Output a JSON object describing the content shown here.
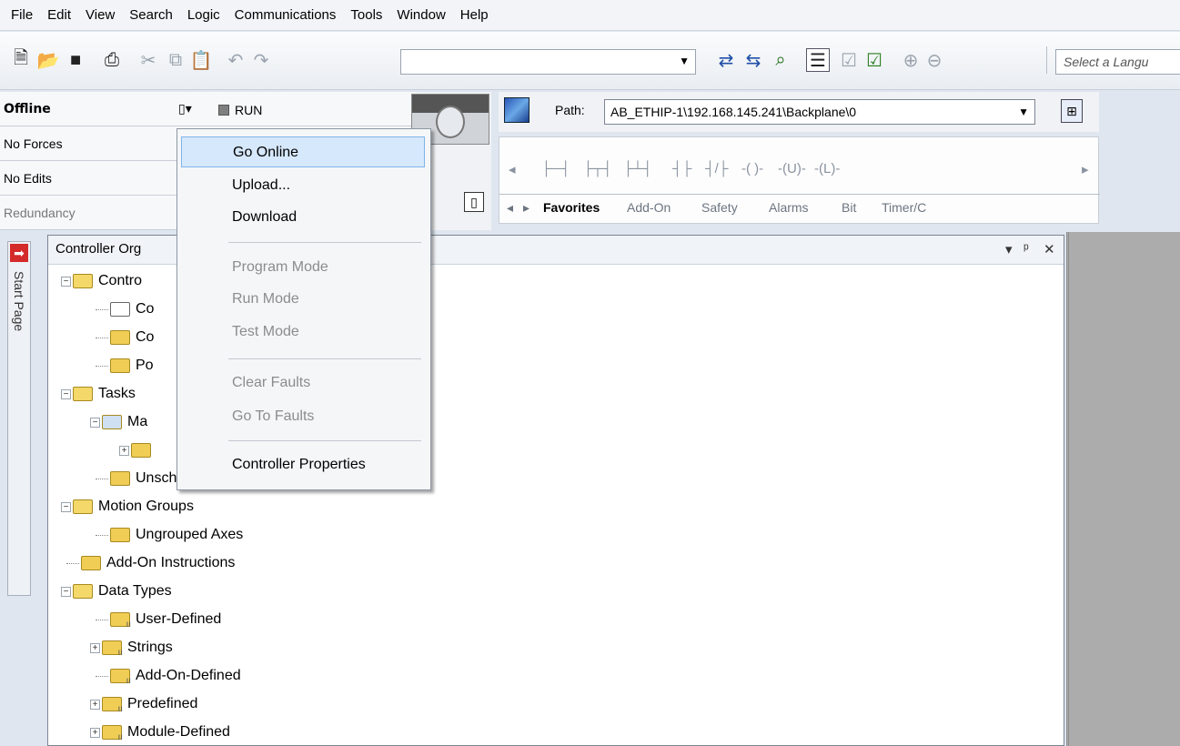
{
  "menubar": {
    "items": [
      "File",
      "Edit",
      "View",
      "Search",
      "Logic",
      "Communications",
      "Tools",
      "Window",
      "Help"
    ]
  },
  "toolbar": {
    "icons": [
      "new-icon",
      "open-icon",
      "save-icon",
      "print-icon",
      "cut-icon",
      "copy-icon",
      "paste-icon",
      "undo-icon",
      "redo-icon",
      "find-icon",
      "find-next-icon",
      "cross-reference-icon",
      "organizer-icon",
      "verify-routine-icon",
      "verify-controller-icon",
      "zoom-in-icon",
      "zoom-out-icon"
    ],
    "search_value": "",
    "language_placeholder": "Select a Langu"
  },
  "status": {
    "offline": "Offline",
    "run": "RUN",
    "no_forces": "No Forces",
    "no_edits": "No Edits",
    "redundancy": "Redundancy"
  },
  "path": {
    "label": "Path:",
    "value": "AB_ETHIP-1\\192.168.145.241\\Backplane\\0"
  },
  "palette": {
    "tabs": [
      "Favorites",
      "Add-On",
      "Safety",
      "Alarms",
      "Bit",
      "Timer/C"
    ]
  },
  "side": {
    "start_page": "Start Page"
  },
  "organizer": {
    "title": "Controller Org",
    "tree": [
      {
        "label": "Contro",
        "indent": 0,
        "expander": "−",
        "icon": "open"
      },
      {
        "label": "Co",
        "indent": 1,
        "icon": "edit"
      },
      {
        "label": "Co",
        "indent": 1,
        "icon": "folder"
      },
      {
        "label": "Po",
        "indent": 1,
        "icon": "folder"
      },
      {
        "label": "Tasks",
        "indent": 0,
        "expander": "−",
        "icon": "open"
      },
      {
        "label": "Ma",
        "indent": 1,
        "expander": "−",
        "icon": "task"
      },
      {
        "label": "",
        "indent": 2,
        "expander": "+",
        "icon": "program"
      },
      {
        "label": "Unscheduled Programs / Phases",
        "indent": 1,
        "icon": "folder"
      },
      {
        "label": "Motion Groups",
        "indent": 0,
        "expander": "−",
        "icon": "open"
      },
      {
        "label": "Ungrouped Axes",
        "indent": 1,
        "icon": "folder"
      },
      {
        "label": "Add-On Instructions",
        "indent": 0,
        "icon": "folder"
      },
      {
        "label": "Data Types",
        "indent": 0,
        "expander": "−",
        "icon": "open"
      },
      {
        "label": "User-Defined",
        "indent": 1,
        "icon": "data"
      },
      {
        "label": "Strings",
        "indent": 1,
        "expander": "+",
        "icon": "data"
      },
      {
        "label": "Add-On-Defined",
        "indent": 1,
        "icon": "data"
      },
      {
        "label": "Predefined",
        "indent": 1,
        "expander": "+",
        "icon": "data"
      },
      {
        "label": "Module-Defined",
        "indent": 1,
        "expander": "+",
        "icon": "data"
      }
    ]
  },
  "context_menu": {
    "items": [
      {
        "label": "Go Online",
        "highlighted": true
      },
      {
        "label": "Upload..."
      },
      {
        "label": "Download"
      },
      {
        "label": "Program Mode",
        "disabled": true
      },
      {
        "label": "Run Mode",
        "disabled": true
      },
      {
        "label": "Test Mode",
        "disabled": true
      },
      {
        "label": "Clear Faults",
        "disabled": true
      },
      {
        "label": "Go To Faults",
        "disabled": true
      },
      {
        "label": "Controller Properties"
      }
    ]
  }
}
